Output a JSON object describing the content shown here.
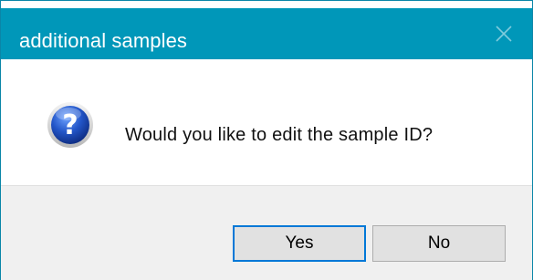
{
  "window": {
    "title": "additional samples"
  },
  "message": {
    "text": "Would you like to edit the sample ID?",
    "icon": "question-icon"
  },
  "buttons": {
    "yes_label": "Yes",
    "no_label": "No",
    "close_icon": "close-icon"
  },
  "colors": {
    "titlebar": "#0097b9",
    "footer": "#f0f0f0",
    "button_face": "#e1e1e1",
    "focus_border": "#0078d7"
  }
}
